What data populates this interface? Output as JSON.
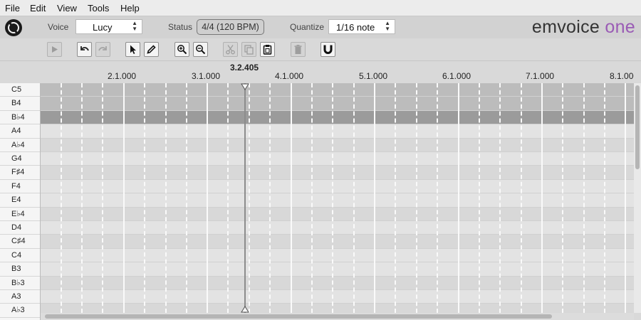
{
  "menu": [
    "File",
    "Edit",
    "View",
    "Tools",
    "Help"
  ],
  "topbar": {
    "voice_label": "Voice",
    "voice_value": "Lucy",
    "status_label": "Status",
    "status_value": "4/4 (120 BPM)",
    "quantize_label": "Quantize",
    "quantize_value": "1/16 note",
    "brand_main": "emvoice",
    "brand_accent": "one"
  },
  "toolbar": {
    "buttons": [
      "play",
      "undo",
      "redo",
      "select",
      "pencil",
      "zoom-in",
      "zoom-out",
      "cut",
      "copy",
      "paste",
      "delete",
      "snap"
    ]
  },
  "ruler": {
    "bars": [
      "2.1.000",
      "3.1.000",
      "4.1.000",
      "5.1.000",
      "6.1.000",
      "7.1.000",
      "8.1.000"
    ],
    "playhead_position": "3.2.405"
  },
  "keys": [
    "C5",
    "B4",
    "B♭4",
    "A4",
    "A♭4",
    "G4",
    "F♯4",
    "F4",
    "E4",
    "E♭4",
    "D4",
    "C♯4",
    "C4",
    "B3",
    "B♭3",
    "A3",
    "A♭3"
  ],
  "selected_key": "B♭4",
  "colors": {
    "brand_accent": "#9a5bb5",
    "background": "#d9d9d9"
  }
}
